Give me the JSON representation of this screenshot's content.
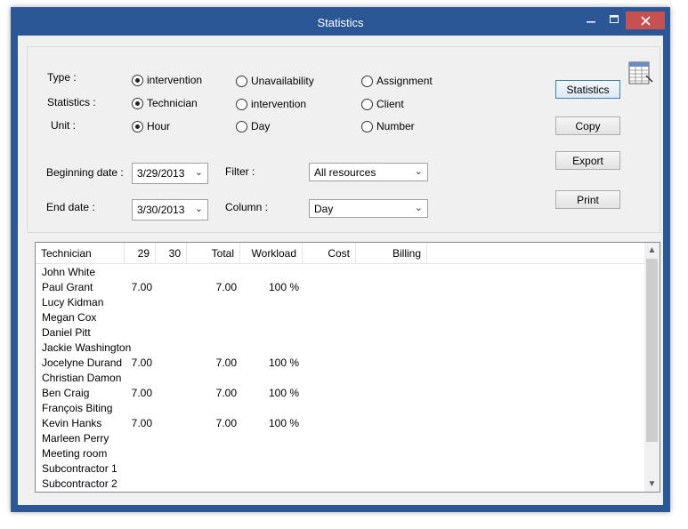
{
  "window": {
    "title": "Statistics"
  },
  "form": {
    "type_label": "Type :",
    "statistics_label": "Statistics :",
    "unit_label": "Unit :",
    "type_options": [
      "intervention",
      "Unavailability",
      "Assignment"
    ],
    "statistics_options": [
      "Technician",
      "intervention",
      "Client"
    ],
    "unit_options": [
      "Hour",
      "Day",
      "Number"
    ],
    "type_selected": "intervention",
    "statistics_selected": "Technician",
    "unit_selected": "Hour",
    "beginning_date_label": "Beginning date :",
    "beginning_date_value": "3/29/2013",
    "end_date_label": "End date :",
    "end_date_value": "3/30/2013",
    "filter_label": "Filter :",
    "filter_value": "All resources",
    "column_label": "Column :",
    "column_value": "Day"
  },
  "buttons": {
    "statistics": "Statistics",
    "copy": "Copy",
    "export": "Export",
    "print": "Print"
  },
  "table": {
    "columns": [
      "Technician",
      "29",
      "30",
      "Total",
      "Workload",
      "Cost",
      "Billing"
    ],
    "rows": [
      [
        "John White",
        "",
        "",
        "",
        "",
        "",
        ""
      ],
      [
        "Paul Grant",
        "7.00",
        "",
        "7.00",
        "100 %",
        "",
        ""
      ],
      [
        "Lucy Kidman",
        "",
        "",
        "",
        "",
        "",
        ""
      ],
      [
        "Megan Cox",
        "",
        "",
        "",
        "",
        "",
        ""
      ],
      [
        "Daniel Pitt",
        "",
        "",
        "",
        "",
        "",
        ""
      ],
      [
        "Jackie Washington",
        "",
        "",
        "",
        "",
        "",
        ""
      ],
      [
        "Jocelyne Durand",
        "7.00",
        "",
        "7.00",
        "100 %",
        "",
        ""
      ],
      [
        "Christian Damon",
        "",
        "",
        "",
        "",
        "",
        ""
      ],
      [
        "Ben Craig",
        "7.00",
        "",
        "7.00",
        "100 %",
        "",
        ""
      ],
      [
        "François Biting",
        "",
        "",
        "",
        "",
        "",
        ""
      ],
      [
        "Kevin Hanks",
        "7.00",
        "",
        "7.00",
        "100 %",
        "",
        ""
      ],
      [
        "Marleen Perry",
        "",
        "",
        "",
        "",
        "",
        ""
      ],
      [
        "Meeting room",
        "",
        "",
        "",
        "",
        "",
        ""
      ],
      [
        "Subcontractor 1",
        "",
        "",
        "",
        "",
        "",
        ""
      ],
      [
        "Subcontractor 2",
        "",
        "",
        "",
        "",
        "",
        ""
      ]
    ]
  },
  "icons": {
    "minimize": "minimize-icon",
    "maximize": "maximize-icon",
    "close": "close-icon",
    "spreadsheet": "spreadsheet-icon"
  },
  "colors": {
    "titlebar": "#2b5797",
    "close_button": "#c75050",
    "window_bg": "#f0f0f0"
  }
}
